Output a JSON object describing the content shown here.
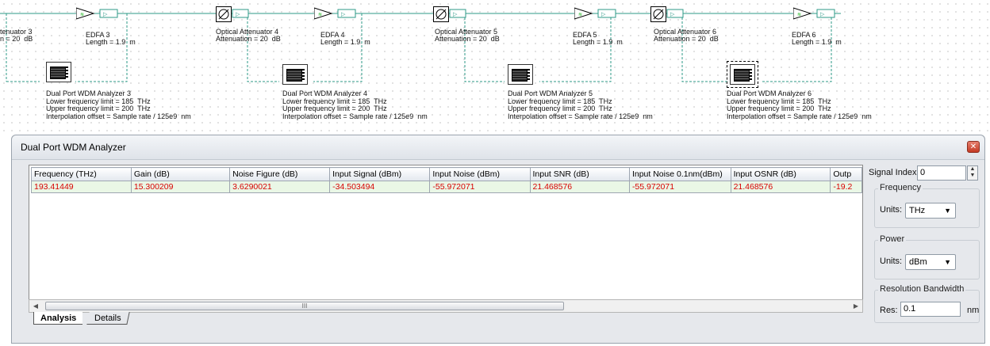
{
  "canvas": {
    "components": [
      {
        "title": "tenuator 3",
        "param": "n = 20  dB"
      },
      {
        "title": "EDFA 3",
        "param": "Length = 1.9  m"
      },
      {
        "title": "Optical Attenuator 4",
        "param": "Attenuation = 20  dB"
      },
      {
        "title": "EDFA 4",
        "param": "Length = 1.9  m"
      },
      {
        "title": "Optical Attenuator 5",
        "param": "Attenuation = 20  dB"
      },
      {
        "title": "EDFA 5",
        "param": "Length = 1.9  m"
      },
      {
        "title": "Optical Attenuator 6",
        "param": "Attenuation = 20  dB"
      },
      {
        "title": "EDFA 6",
        "param": "Length = 1.9  m"
      }
    ],
    "analyzers": [
      {
        "title": "Dual Port WDM Analyzer 3",
        "lower": "Lower frequency limit = 185  THz",
        "upper": "Upper frequency limit = 200  THz",
        "interp": "Interpolation offset = Sample rate / 125e9  nm"
      },
      {
        "title": "Dual Port WDM Analyzer 4",
        "lower": "Lower frequency limit = 185  THz",
        "upper": "Upper frequency limit = 200  THz",
        "interp": "Interpolation offset = Sample rate / 125e9  nm"
      },
      {
        "title": "Dual Port WDM Analyzer 5",
        "lower": "Lower frequency limit = 185  THz",
        "upper": "Upper frequency limit = 200  THz",
        "interp": "Interpolation offset = Sample rate / 125e9  nm"
      },
      {
        "title": "Dual Port WDM Analyzer 6",
        "lower": "Lower frequency limit = 185  THz",
        "upper": "Upper frequency limit = 200  THz",
        "interp": "Interpolation offset = Sample rate / 125e9  nm"
      }
    ]
  },
  "panel": {
    "title": "Dual Port WDM Analyzer",
    "close_icon": "close-icon",
    "columns": [
      "Frequency (THz)",
      "Gain (dB)",
      "Noise Figure (dB)",
      "Input Signal (dBm)",
      "Input Noise (dBm)",
      "Input SNR (dB)",
      "Input Noise 0.1nm(dBm)",
      "Input OSNR (dB)",
      "Outp"
    ],
    "rows": [
      [
        "193.41449",
        "15.300209",
        "3.6290021",
        "-34.503494",
        "-55.972071",
        "21.468576",
        "-55.972071",
        "21.468576",
        "-19.2"
      ]
    ],
    "scroll_grip": "III",
    "tabs": [
      "Analysis",
      "Details"
    ]
  },
  "side": {
    "signal_index_label": "Signal Index:",
    "signal_index_value": "0",
    "frequency": {
      "title": "Frequency",
      "units_label": "Units:",
      "units_value": "THz"
    },
    "power": {
      "title": "Power",
      "units_label": "Units:",
      "units_value": "dBm"
    },
    "resolution": {
      "title": "Resolution Bandwidth",
      "res_label": "Res:",
      "res_value": "0.1",
      "unit": "nm"
    }
  },
  "colors": {
    "wire": "#2e9a87",
    "value_text": "#d80000",
    "selected_row": "#eaf7e6"
  }
}
